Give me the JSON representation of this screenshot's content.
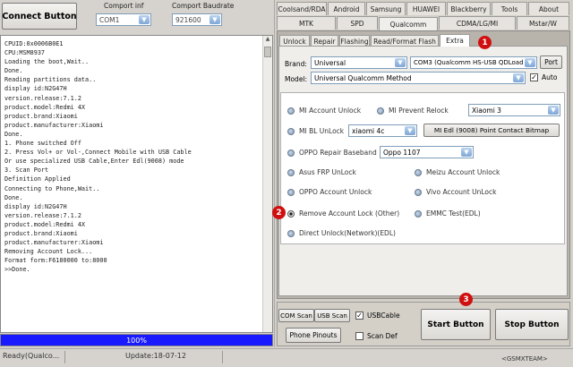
{
  "connect_button": "Connect Button",
  "comport": {
    "label": "Comport inf",
    "value": "COM1"
  },
  "baud": {
    "label": "Comport Baudrate",
    "value": "921600"
  },
  "log_lines": [
    "CPUID:0x0006B0E1",
    "CPU:MSM8937",
    "Loading the boot,Wait..",
    "Done.",
    "Reading partitions data..",
    "display id:N2G47H",
    "version.release:7.1.2",
    "product.model:Redmi 4X",
    "product.brand:Xiaomi",
    "product.manufacturer:Xiaomi",
    "Done.",
    "1. Phone switched Off",
    "2. Press Vol+ or Vol-,Connect Mobile with USB Cable",
    "Or use specialized USB Cable,Enter Edl(9008) mode",
    "3. Scan Port",
    "Definition Applied",
    "Connecting to Phone,Wait..",
    "Done.",
    "display id:N2G47H",
    "version.release:7.1.2",
    "product.model:Redmi 4X",
    "product.brand:Xiaomi",
    "product.manufacturer:Xiaomi",
    "Removing Account Lock...",
    "Format form:F6180000 to:8000",
    ">>Done."
  ],
  "progress": {
    "text": "100%",
    "fraction": 1.0,
    "color": "#1a1aff"
  },
  "status": {
    "left": "Ready(Qualco...",
    "update": "Update:18-07-12",
    "team": "<GSMXTEAM>"
  },
  "tabs_row1": [
    "Coolsand/RDA",
    "Android",
    "Samsung",
    "HUAWEI",
    "Blackberry",
    "Tools",
    "About"
  ],
  "tabs_row2": [
    "MTK",
    "SPD",
    "Qualcomm",
    "CDMA/LG/MI",
    "Mstar/W"
  ],
  "sub_tabs": [
    "Unlock",
    "Repair",
    "Flashing",
    "Read/Format Flash",
    "Extra"
  ],
  "brand": {
    "label": "Brand:",
    "value": "Universal",
    "port_value": "COM3 (Qualcomm HS-USB QDLoad",
    "port_button": "Port"
  },
  "model": {
    "label": "Model:",
    "value": "Universal Qualcomm Method",
    "auto_label": "Auto"
  },
  "options": {
    "mi_account_unlock": "MI Account Unlock",
    "mi_prevent_relock": "MI Prevent Relock",
    "mi_prevent_value": "Xiaomi 3",
    "mi_bl_unlock": "MI BL UnLock",
    "mi_bl_value": "xiaomi 4c",
    "mi_edl_button": "MI Edl (9008) Point Contact Bitmap",
    "oppo_repair": "OPPO Repair Baseband",
    "oppo_value": "Oppo 1107",
    "asus_frp": "Asus FRP UnLock",
    "meizu": "Meizu Account Unlock",
    "oppo_account": "OPPO Account Unlock",
    "vivo": "Vivo Account UnLock",
    "remove_account": "Remove Account Lock (Other)",
    "emmc": "EMMC Test(EDL)",
    "direct_unlock": "Direct Unlock(Network)(EDL)"
  },
  "bottom": {
    "com_scan": "COM Scan",
    "usb_scan": "USB Scan",
    "usb_cable": "USBCable",
    "phone_pinouts": "Phone Pinouts",
    "scan_def": "Scan Def",
    "start": "Start Button",
    "stop": "Stop Button"
  },
  "badges": [
    "1",
    "2",
    "3"
  ]
}
